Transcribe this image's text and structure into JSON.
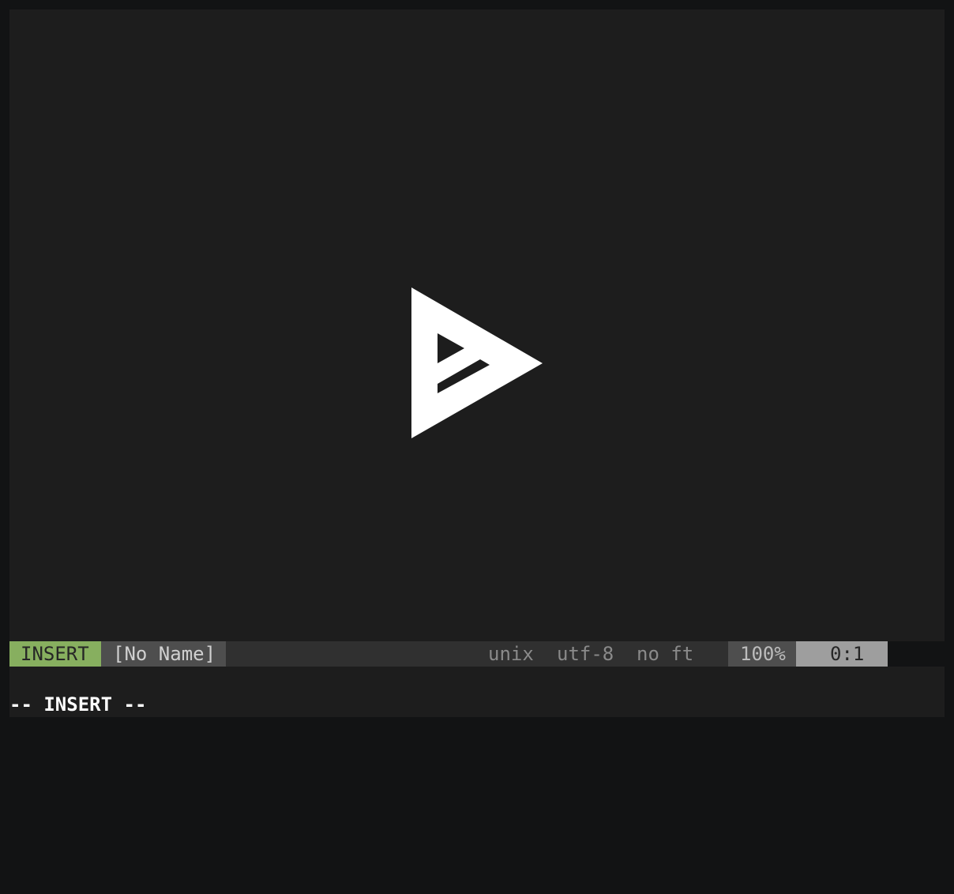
{
  "statusline": {
    "mode": "INSERT",
    "filename": "[No Name]",
    "fileformat": "unix",
    "encoding": "utf-8",
    "filetype": "no ft",
    "percent": "100%",
    "position": "0:1"
  },
  "cmdline": {
    "text": "-- INSERT --"
  },
  "overlay": {
    "icon": "play-icon"
  },
  "colors": {
    "background": "#1d1d1d",
    "frame": "#121314",
    "mode_bg": "#87af5f",
    "filename_bg": "#4e4e4e",
    "middle_bg": "#303030",
    "position_bg": "#9e9e9e"
  }
}
